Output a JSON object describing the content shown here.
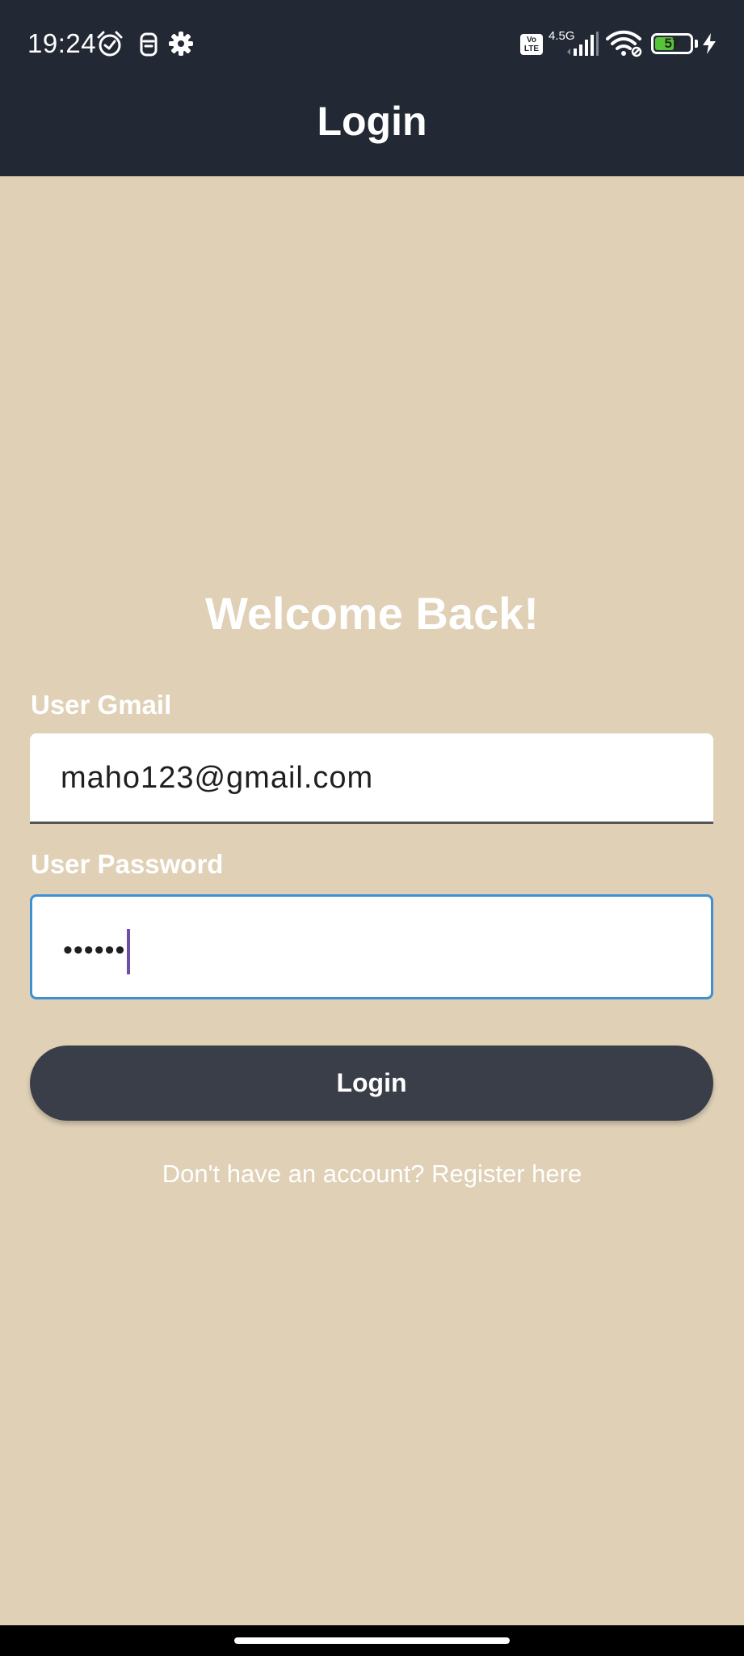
{
  "status_bar": {
    "time": "19:24",
    "network_badge": "Vo\nLTE",
    "network_type": "4.5G",
    "battery_percent": "57",
    "battery_level": 0.57,
    "icons": [
      "alarm-icon",
      "clipboard-icon",
      "gear-icon",
      "signal-icon",
      "wifi-icon",
      "battery-icon",
      "charging-icon"
    ]
  },
  "app_bar": {
    "title": "Login"
  },
  "main": {
    "welcome": "Welcome Back!",
    "email_label": "User Gmail",
    "email_value": "maho123@gmail.com",
    "password_label": "User Password",
    "password_value": "••••••",
    "login_button": "Login",
    "register_text": "Don't have an account? Register here"
  },
  "colors": {
    "app_bar_bg": "#222834",
    "page_bg": "#dfd0b6",
    "button_bg": "#3a3e49",
    "focus_border": "#3e8fd6",
    "caret": "#6e4fa6",
    "battery_fill": "#58c43b"
  }
}
